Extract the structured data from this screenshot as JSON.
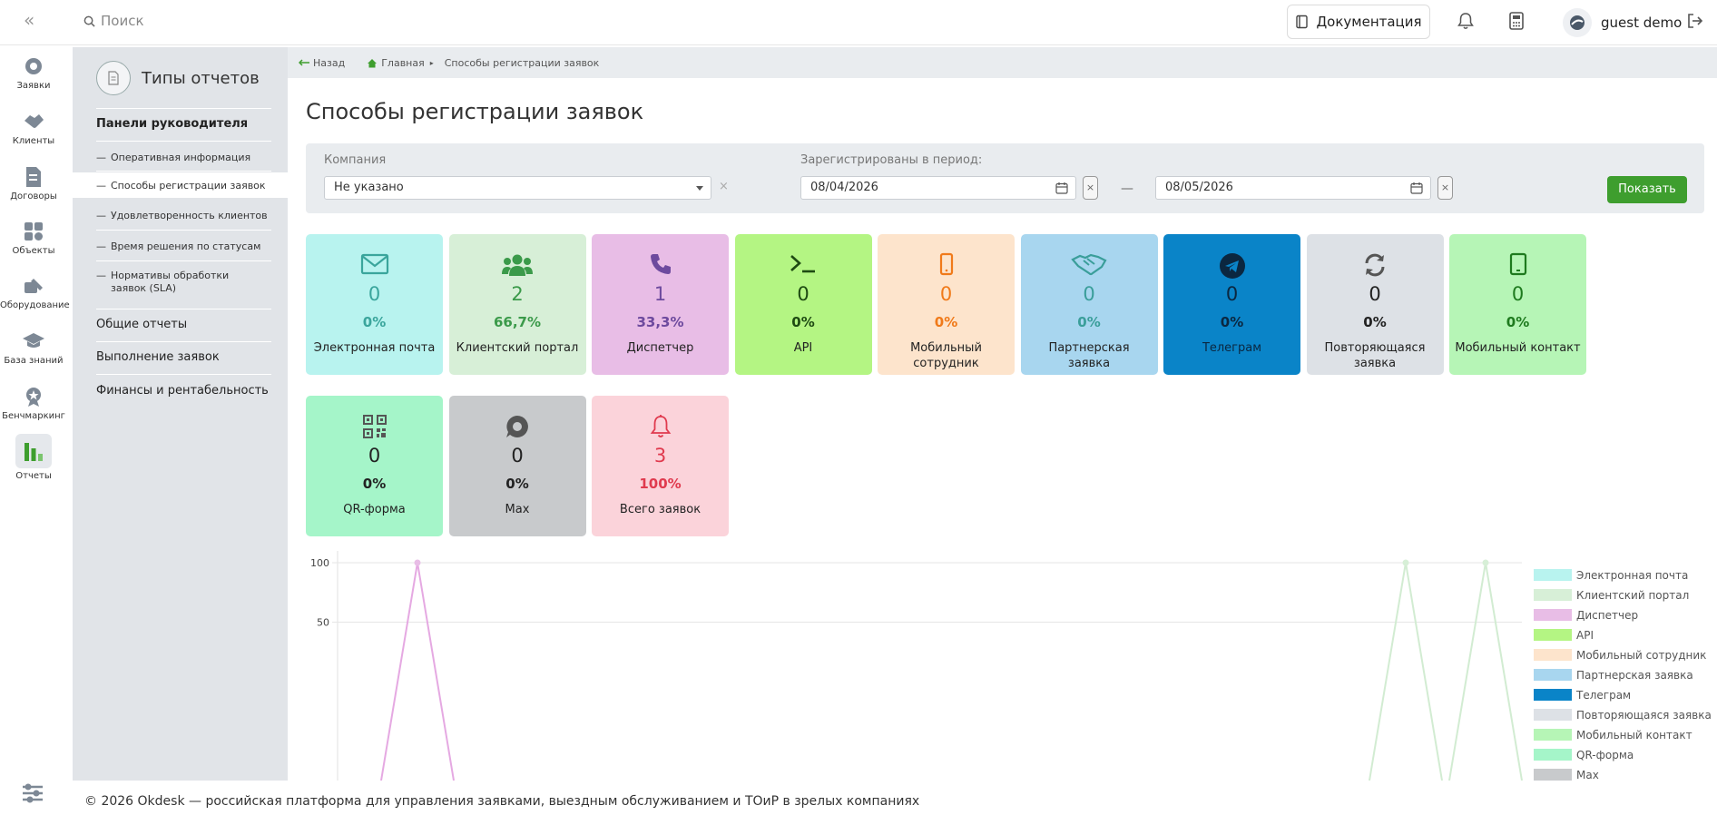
{
  "topbar": {
    "collapse_icon": "double-chevron-left-icon",
    "search_placeholder": "Поиск",
    "doc_label": "Документация",
    "user_name": "guest demo"
  },
  "nav": [
    {
      "label": "Заявки",
      "icon": "ticket-icon"
    },
    {
      "label": "Клиенты",
      "icon": "handshake-icon"
    },
    {
      "label": "Договоры",
      "icon": "contract-icon"
    },
    {
      "label": "Объекты",
      "icon": "objects-icon"
    },
    {
      "label": "Оборудование",
      "icon": "equipment-icon"
    },
    {
      "label": "База знаний",
      "icon": "graduation-cap-icon"
    },
    {
      "label": "Бенчмаркинг",
      "icon": "benchmark-icon"
    },
    {
      "label": "Отчеты",
      "icon": "bar-chart-icon"
    }
  ],
  "report_panel": {
    "title": "Типы отчетов",
    "group1": "Панели руководителя",
    "items": [
      "Оперативная информация",
      "Способы регистрации заявок",
      "Удовлетворенность клиентов",
      "Время решения по статусам",
      "Нормативы обработки заявок (SLA)"
    ],
    "group2": "Общие отчеты",
    "group3": "Выполнение заявок",
    "group4": "Финансы и рентабельность"
  },
  "breadcrumb": {
    "back": "Назад",
    "home": "Главная",
    "current": "Способы регистрации заявок"
  },
  "page_title": "Способы регистрации заявок",
  "filters": {
    "company_label": "Компания",
    "company_value": "Не указано",
    "period_label": "Зарегистрированы в период:",
    "date_from": "08/04/2026",
    "date_to": "08/05/2026",
    "dash": "—",
    "clear": "×",
    "show_button": "Показать"
  },
  "cards": [
    {
      "label": "Электронная почта",
      "count": "0",
      "pct": "0%",
      "bg": "#b8f3ef",
      "fg": "#3aa59c",
      "icon": "envelope-icon"
    },
    {
      "label": "Клиентский портал",
      "count": "2",
      "pct": "66,7%",
      "bg": "#d7efd7",
      "fg": "#3b9a4a",
      "icon": "users-icon"
    },
    {
      "label": "Диспетчер",
      "count": "1",
      "pct": "33,3%",
      "bg": "#e8bde6",
      "fg": "#6d4a9e",
      "icon": "phone-icon"
    },
    {
      "label": "API",
      "count": "0",
      "pct": "0%",
      "bg": "#b4f583",
      "fg": "#1e4a12",
      "icon": "terminal-icon"
    },
    {
      "label": "Мобильный сотрудник",
      "count": "0",
      "pct": "0%",
      "bg": "#fde4cc",
      "fg": "#f07a1a",
      "icon": "mobile-icon"
    },
    {
      "label": "Партнерская заявка",
      "count": "0",
      "pct": "0%",
      "bg": "#a8d6ef",
      "fg": "#3a9e9a",
      "icon": "handshake-icon"
    },
    {
      "label": "Телеграм",
      "count": "0",
      "pct": "0%",
      "bg": "#0a84c8",
      "fg": "#0b2740",
      "icon": "telegram-icon"
    },
    {
      "label": "Повторяющаяся заявка",
      "count": "0",
      "pct": "0%",
      "bg": "#dde1e6",
      "fg": "#222222",
      "icon": "refresh-icon"
    },
    {
      "label": "Мобильный контакт",
      "count": "0",
      "pct": "0%",
      "bg": "#b6f5b6",
      "fg": "#1e7a1e",
      "icon": "tablet-icon"
    },
    {
      "label": "QR-форма",
      "count": "0",
      "pct": "0%",
      "bg": "#a5f5c9",
      "fg": "#222222",
      "icon": "qr-icon"
    },
    {
      "label": "Max",
      "count": "0",
      "pct": "0%",
      "bg": "#c8cacc",
      "fg": "#222222",
      "icon": "max-chat-icon"
    },
    {
      "label": "Всего заявок",
      "count": "3",
      "pct": "100%",
      "bg": "#fbd3da",
      "fg": "#e03a4e",
      "icon": "bell-icon"
    }
  ],
  "chart_data": {
    "type": "line",
    "y_ticks": [
      "100",
      "50"
    ],
    "ylim": [
      0,
      100
    ],
    "series": [
      {
        "name": "Электронная почта",
        "color": "#b8f3ef"
      },
      {
        "name": "Клиентский портал",
        "color": "#d7efd7"
      },
      {
        "name": "Диспетчер",
        "color": "#e8bde6"
      },
      {
        "name": "API",
        "color": "#b4f583"
      },
      {
        "name": "Мобильный сотрудник",
        "color": "#fde4cc"
      },
      {
        "name": "Партнерская заявка",
        "color": "#a8d6ef"
      },
      {
        "name": "Телеграм",
        "color": "#0a84c8"
      },
      {
        "name": "Повторяющаяся заявка",
        "color": "#dde1e6"
      },
      {
        "name": "Мобильный контакт",
        "color": "#b6f5b6"
      },
      {
        "name": "QR-форма",
        "color": "#a5f5c9"
      },
      {
        "name": "Max",
        "color": "#c8cacc"
      }
    ],
    "peaks": [
      {
        "series": "Диспетчер",
        "value": 100
      },
      {
        "series": "Клиентский портал",
        "value": 100
      },
      {
        "series": "Клиентский портал",
        "value": 100
      }
    ]
  },
  "footer": {
    "text": "© 2026 Okdesk — российская платформа для управления заявками, выездным обслуживанием и ТОиР в зрелых компаниях"
  }
}
